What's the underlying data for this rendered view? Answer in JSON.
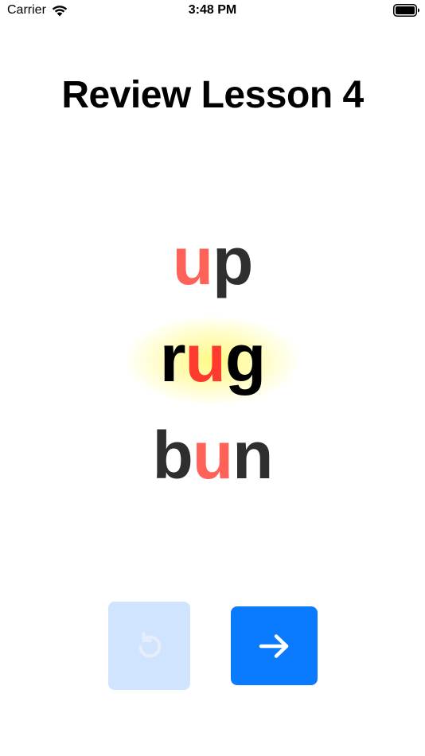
{
  "status_bar": {
    "carrier": "Carrier",
    "time": "3:48 PM"
  },
  "header": {
    "title": "Review Lesson 4"
  },
  "words": [
    {
      "text": "up",
      "parts": [
        "",
        "u",
        "p"
      ],
      "highlighted": false
    },
    {
      "text": "rug",
      "parts": [
        "r",
        "u",
        "g"
      ],
      "highlighted": true
    },
    {
      "text": "bun",
      "parts": [
        "b",
        "u",
        "n"
      ],
      "highlighted": false
    }
  ],
  "controls": {
    "replay": {
      "icon": "replay-icon",
      "enabled": false
    },
    "next": {
      "icon": "arrow-right-icon",
      "enabled": true
    }
  },
  "colors": {
    "vowel": "#ff6259",
    "vowel_highlighted": "#ff3b30",
    "consonant": "#2f2f2f",
    "highlight_glow": "#fff85a",
    "next_button": "#0a7aff",
    "replay_button_disabled": "#d0e4fd"
  }
}
